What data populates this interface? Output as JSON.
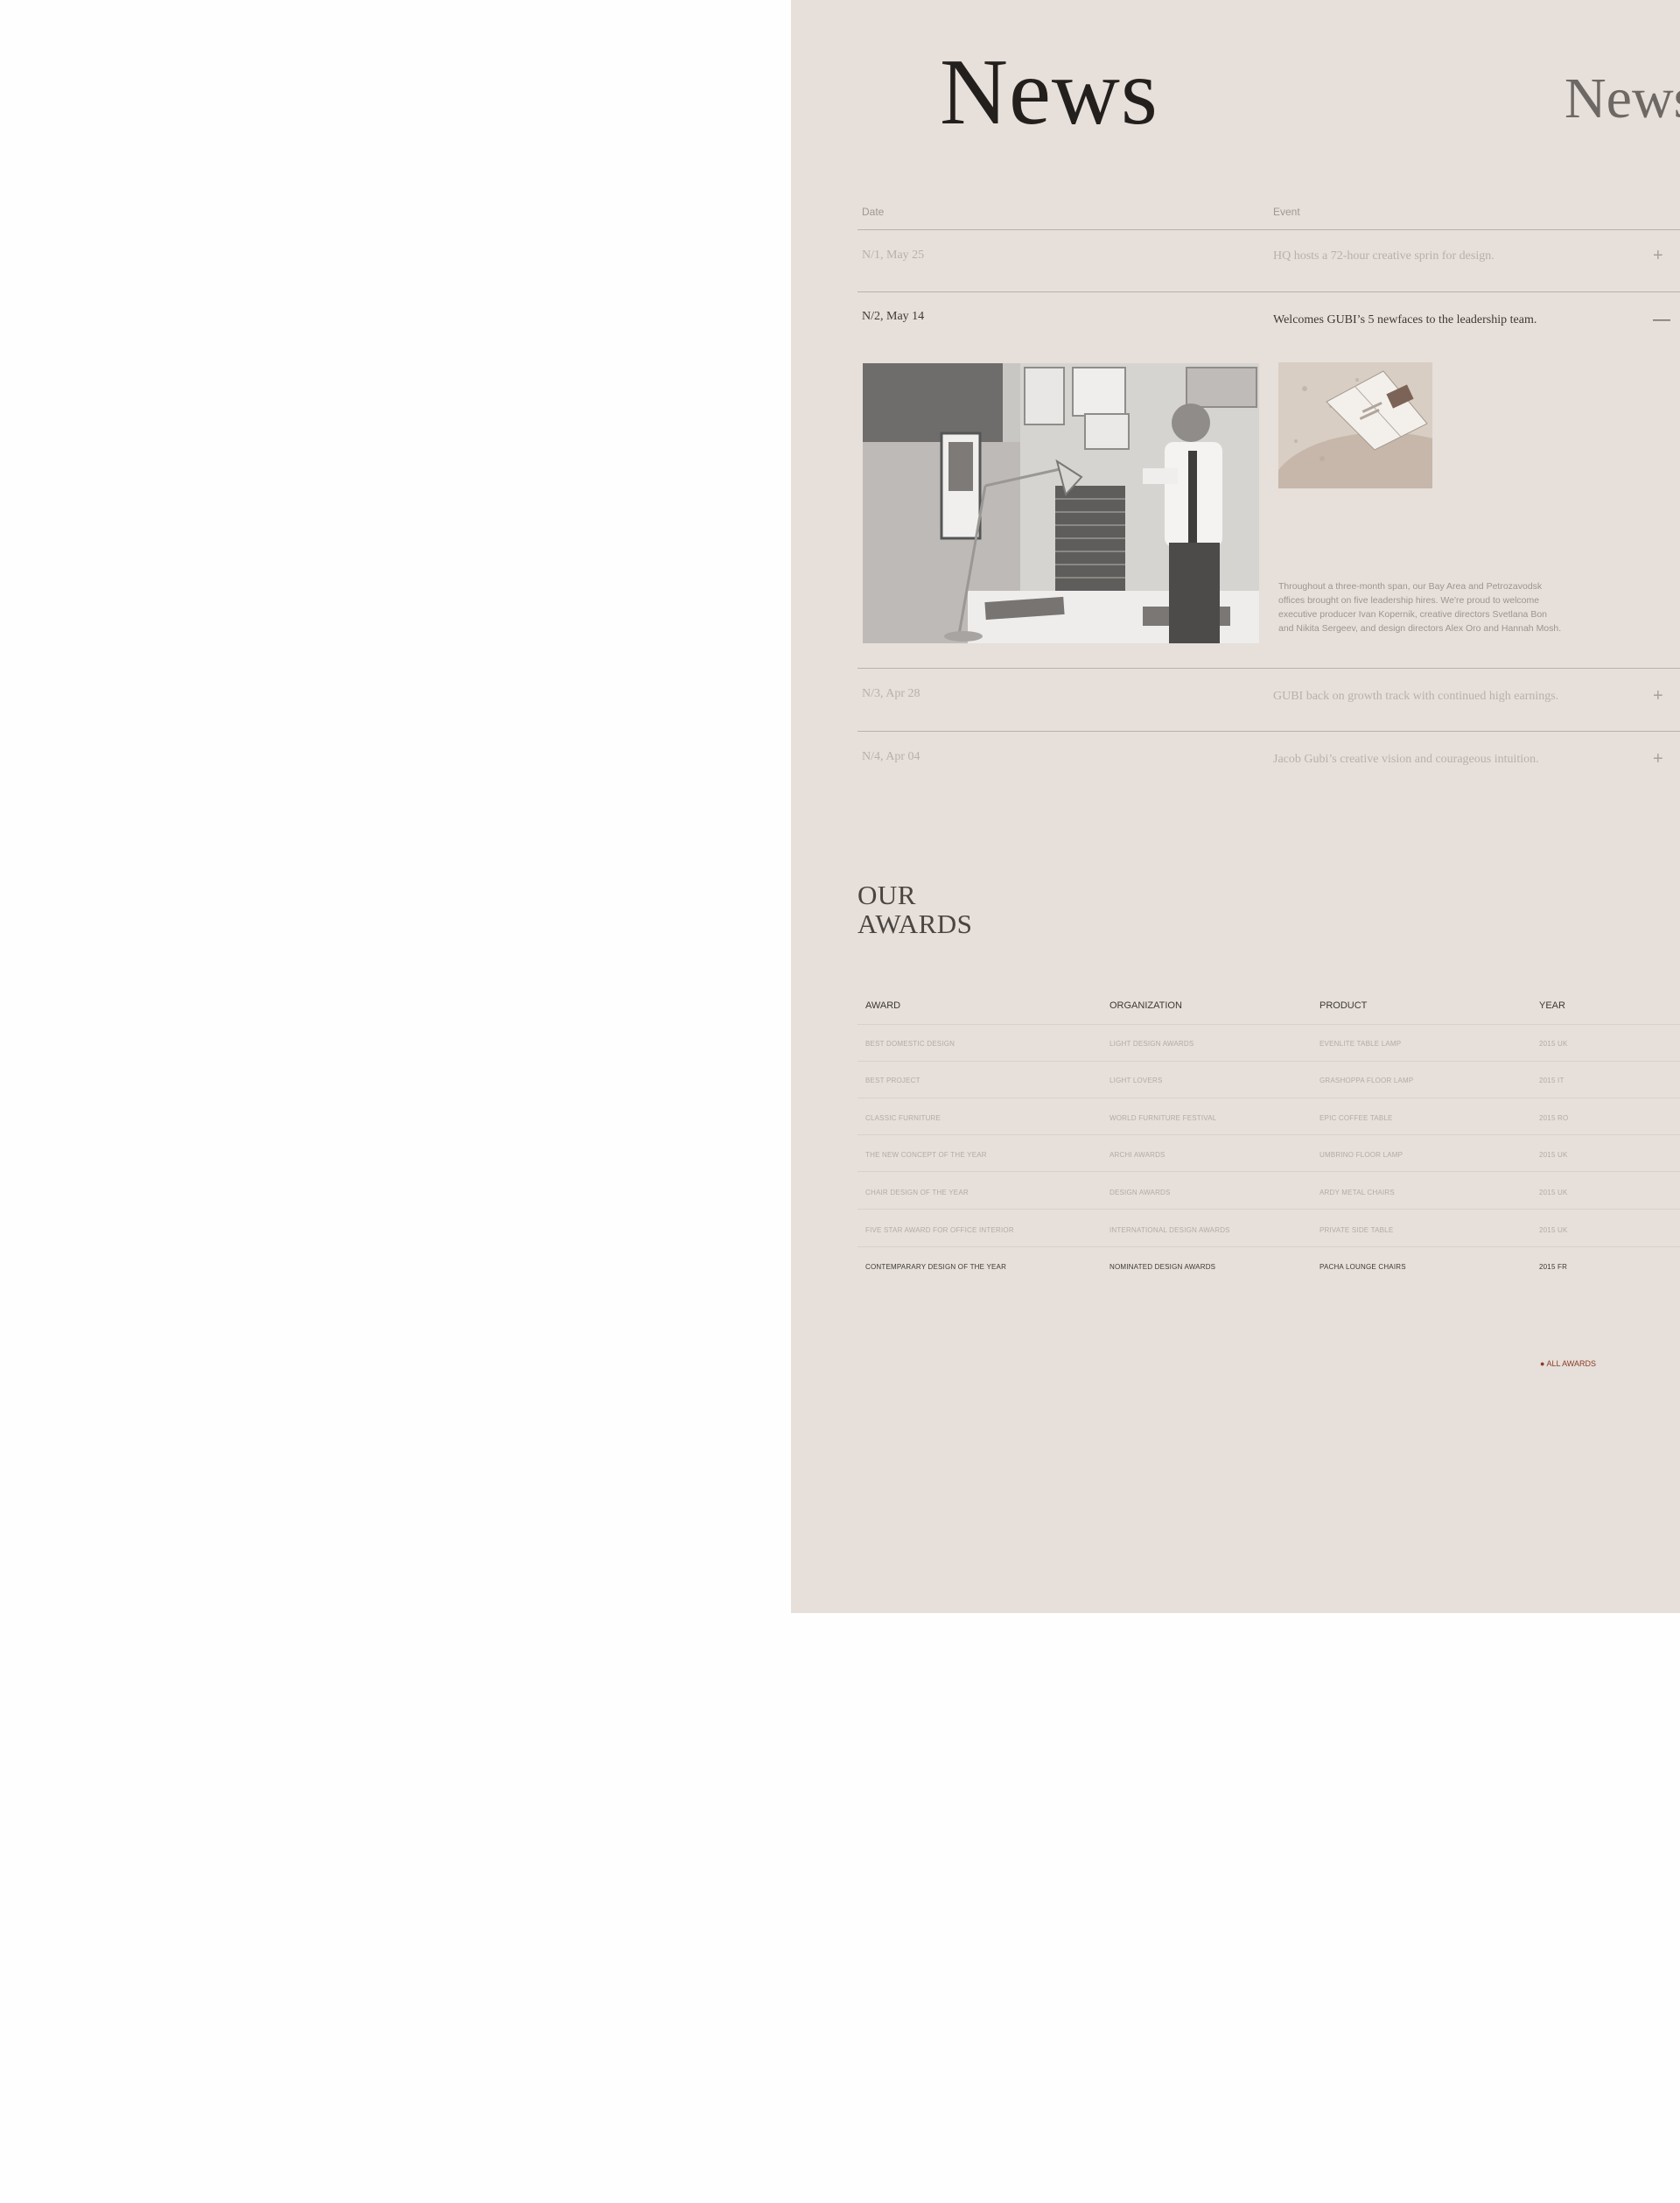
{
  "page": {
    "title": "News",
    "title_echo": "News"
  },
  "news": {
    "headers": {
      "date": "Date",
      "event": "Event"
    },
    "rows": [
      {
        "date": "N/1, May 25",
        "event": "HQ hosts a 72-hour creative sprin for design.",
        "toggle": "+"
      },
      {
        "date": "N/2, May 14",
        "event": "Welcomes GUBI’s 5 newfaces to the leadership team.",
        "toggle": "—"
      },
      {
        "date": "N/3, Apr 28",
        "event": "GUBI back on growth track with continued high earnings.",
        "toggle": "+"
      },
      {
        "date": "N/4, Apr 04",
        "event": "Jacob Gubi’s creative vision and courageous intuition.",
        "toggle": "+"
      }
    ],
    "expanded": {
      "text": "Throughout a three-month span, our Bay Area and Petrozavodsk offices brought on five leadership hires. We're proud to welcome executive producer Ivan Kopernik, creative directors Svetlana Bon and Nikita Sergeev, and design directors Alex Oro and Hannah Mosh."
    }
  },
  "awards": {
    "title_line1": "OUR",
    "title_line2": "AWARDS",
    "headers": {
      "award": "AWARD",
      "organization": "ORGANIZATION",
      "product": "PRODUCT",
      "year": "YEAR"
    },
    "rows": [
      {
        "award": "BEST DOMESTIC DESIGN",
        "organization": "LIGHT DESIGN AWARDS",
        "product": "EVENLITE TABLE LAMP",
        "year": "2015  UK"
      },
      {
        "award": "BEST PROJECT",
        "organization": "LIGHT LOVERS",
        "product": "GRASHOPPA FLOOR LAMP",
        "year": "2015  IT"
      },
      {
        "award": "CLASSIC FURNITURE",
        "organization": "WORLD FURNITURE FESTIVAL",
        "product": "EPIC COFFEE TABLE",
        "year": "2015  RO"
      },
      {
        "award": "THE NEW CONCEPT OF THE YEAR",
        "organization": "ARCHI AWARDS",
        "product": "UMBRINO FLOOR LAMP",
        "year": "2015  UK"
      },
      {
        "award": "CHAIR DESIGN OF THE YEAR",
        "organization": "DESIGN AWARDS",
        "product": "ARDY METAL CHAIRS",
        "year": "2015  UK"
      },
      {
        "award": "FIVE STAR AWARD FOR OFFICE INTERIOR",
        "organization": "INTERNATIONAL DESIGN AWARDS",
        "product": "PRIVATE SIDE TABLE",
        "year": "2015  UK"
      },
      {
        "award": "CONTEMPARARY DESIGN OF THE YEAR",
        "organization": "NOMINATED DESIGN AWARDS",
        "product": "PACHA LOUNGE CHAIRS",
        "year": "2015  FR"
      }
    ],
    "all_link": "ALL AWARDS",
    "link_bullet": "●"
  }
}
